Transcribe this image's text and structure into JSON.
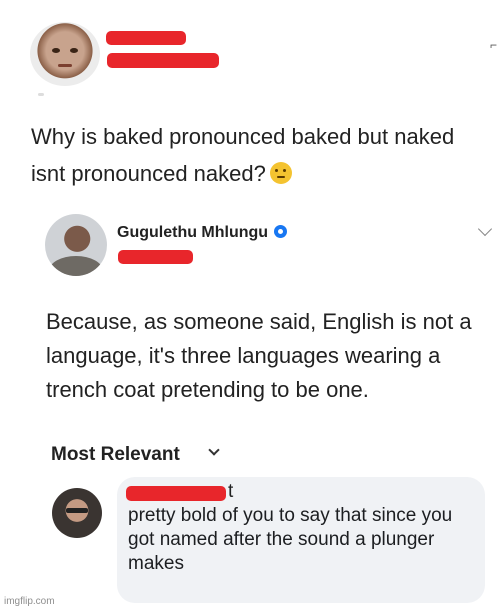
{
  "post": {
    "question": "Why is baked pronounced baked but naked isnt pronounced naked?",
    "emoji": "thinking-face-icon"
  },
  "reply": {
    "author": "Gugulethu Mhlungu",
    "text": "Because, as someone said, English is not a language, it's three languages wearing a trench coat pretending to be one."
  },
  "comments_sort": {
    "label": "Most Relevant"
  },
  "comment": {
    "author_suffix": "t",
    "text": "pretty bold of you to say that since you got named after the sound a plunger makes"
  },
  "watermark": "imgflip.com",
  "colors": {
    "redaction": "#e8262b",
    "verified": "#1877f2",
    "bubble": "#f0f2f5"
  }
}
